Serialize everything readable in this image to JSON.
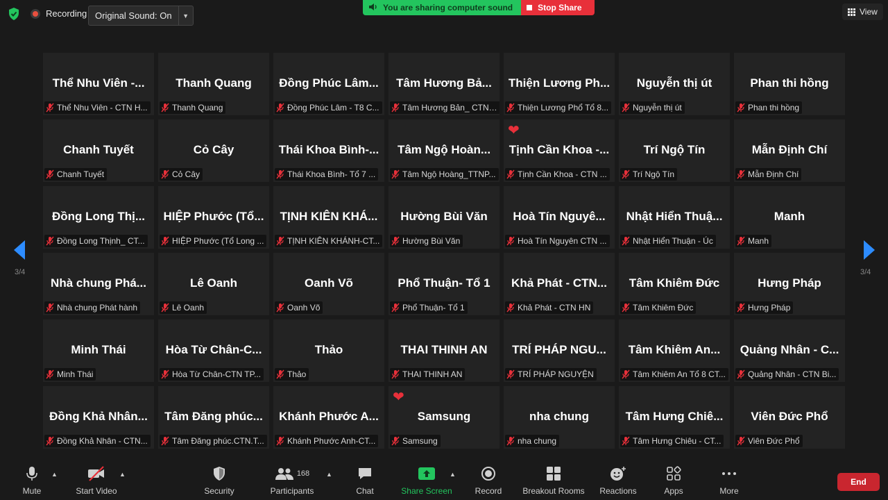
{
  "top": {
    "recording": "Recording",
    "original_sound": "Original Sound: On",
    "sharing_banner": "You are sharing computer sound",
    "stop_share": "Stop Share",
    "view": "View"
  },
  "pager": {
    "left": "3/4",
    "right": "3/4"
  },
  "tiles": [
    {
      "name": "Thể Nhu Viên -...",
      "label": "Thể Nhu Viên - CTN H..."
    },
    {
      "name": "Thanh Quang",
      "label": "Thanh Quang"
    },
    {
      "name": "Đồng Phúc Lâm...",
      "label": "Đồng Phúc Lâm - T8 C..."
    },
    {
      "name": "Tâm Hương Bả...",
      "label": "Tâm Hương Bản_ CTN_..."
    },
    {
      "name": "Thiện Lương Ph...",
      "label": "Thiện Lương Phổ  Tổ 8..."
    },
    {
      "name": "Nguyễn thị út",
      "label": "Nguyễn thị út"
    },
    {
      "name": "Phan thi  hồng",
      "label": "Phan thi  hồng"
    },
    {
      "name": "Chanh Tuyết",
      "label": "Chanh Tuyết"
    },
    {
      "name": "Cỏ Cây",
      "label": "Cỏ Cây"
    },
    {
      "name": "Thái Khoa Bình-...",
      "label": "Thái Khoa Bình- Tổ 7 ..."
    },
    {
      "name": "Tâm Ngộ Hoàn...",
      "label": "Tâm Ngộ Hoàng_TTNP..."
    },
    {
      "name": "Tịnh Cần Khoa -...",
      "label": "Tịnh Cần Khoa - CTN ...",
      "heart": true
    },
    {
      "name": "Trí Ngộ Tín",
      "label": "Trí Ngộ Tín"
    },
    {
      "name": "Mẫn Định Chí",
      "label": "Mẫn Định Chí"
    },
    {
      "name": "Đồng Long Thị...",
      "label": "Đồng Long Thịnh_ CT..."
    },
    {
      "name": "HIỆP Phước (Tổ...",
      "label": "HIỆP Phước (Tổ  Long ..."
    },
    {
      "name": "TỊNH KIÊN KHÁ...",
      "label": "TỊNH KIÊN KHÁNH-CT..."
    },
    {
      "name": "Hường Bùi Văn",
      "label": "Hường Bùi Văn"
    },
    {
      "name": "Hoà Tín Nguyê...",
      "label": "Hoà Tín Nguyên CTN ..."
    },
    {
      "name": "Nhật Hiển Thuậ...",
      "label": "Nhật Hiển Thuận - Úc"
    },
    {
      "name": "Manh",
      "label": "Manh"
    },
    {
      "name": "Nhà chung Phá...",
      "label": "Nhà chung Phát hành"
    },
    {
      "name": "Lê Oanh",
      "label": "Lê Oanh"
    },
    {
      "name": "Oanh Võ",
      "label": "Oanh Võ"
    },
    {
      "name": "Phổ Thuận- Tổ 1",
      "label": "Phổ Thuận- Tổ 1"
    },
    {
      "name": "Khả Phát - CTN...",
      "label": "Khả Phát - CTN HN"
    },
    {
      "name": "Tâm Khiêm Đức",
      "label": "Tâm Khiêm Đức"
    },
    {
      "name": "Hưng Pháp",
      "label": "Hưng Pháp"
    },
    {
      "name": "Minh Thái",
      "label": "Minh Thái"
    },
    {
      "name": "Hòa Từ Chân-C...",
      "label": "Hòa Từ Chân-CTN TP..."
    },
    {
      "name": "Thảo",
      "label": "Thảo"
    },
    {
      "name": "THAI THINH AN",
      "label": "THAI THINH AN"
    },
    {
      "name": "TRÍ PHÁP NGU...",
      "label": "TRÍ PHÁP NGUYỆN"
    },
    {
      "name": "Tâm Khiêm An...",
      "label": "Tâm Khiêm An Tổ 8 CT..."
    },
    {
      "name": "Quảng Nhân - C...",
      "label": "Quảng Nhân - CTN Bi..."
    },
    {
      "name": "Đồng Khả Nhân...",
      "label": "Đồng Khả Nhân - CTN..."
    },
    {
      "name": "Tâm Đăng phúc...",
      "label": "Tâm Đăng phúc.CTN.T..."
    },
    {
      "name": "Khánh Phước A...",
      "label": "Khánh Phước Anh-CT..."
    },
    {
      "name": "Samsung",
      "label": "Samsung",
      "heart": true
    },
    {
      "name": "nha chung",
      "label": "nha chung"
    },
    {
      "name": "Tâm Hưng Chiê...",
      "label": "Tâm Hưng Chiêu - CT..."
    },
    {
      "name": "Viên Đức Phổ",
      "label": "Viên Đức Phổ"
    }
  ],
  "toolbar": {
    "mute": "Mute",
    "start_video": "Start Video",
    "security": "Security",
    "participants": "Participants",
    "participants_count": "168",
    "chat": "Chat",
    "share_screen": "Share Screen",
    "record": "Record",
    "breakout_rooms": "Breakout Rooms",
    "reactions": "Reactions",
    "apps": "Apps",
    "more": "More",
    "end": "End"
  },
  "colors": {
    "accent_blue": "#2d8cff",
    "share_green": "#23c55e",
    "stop_red": "#e8303a",
    "end_red": "#c9262f"
  }
}
